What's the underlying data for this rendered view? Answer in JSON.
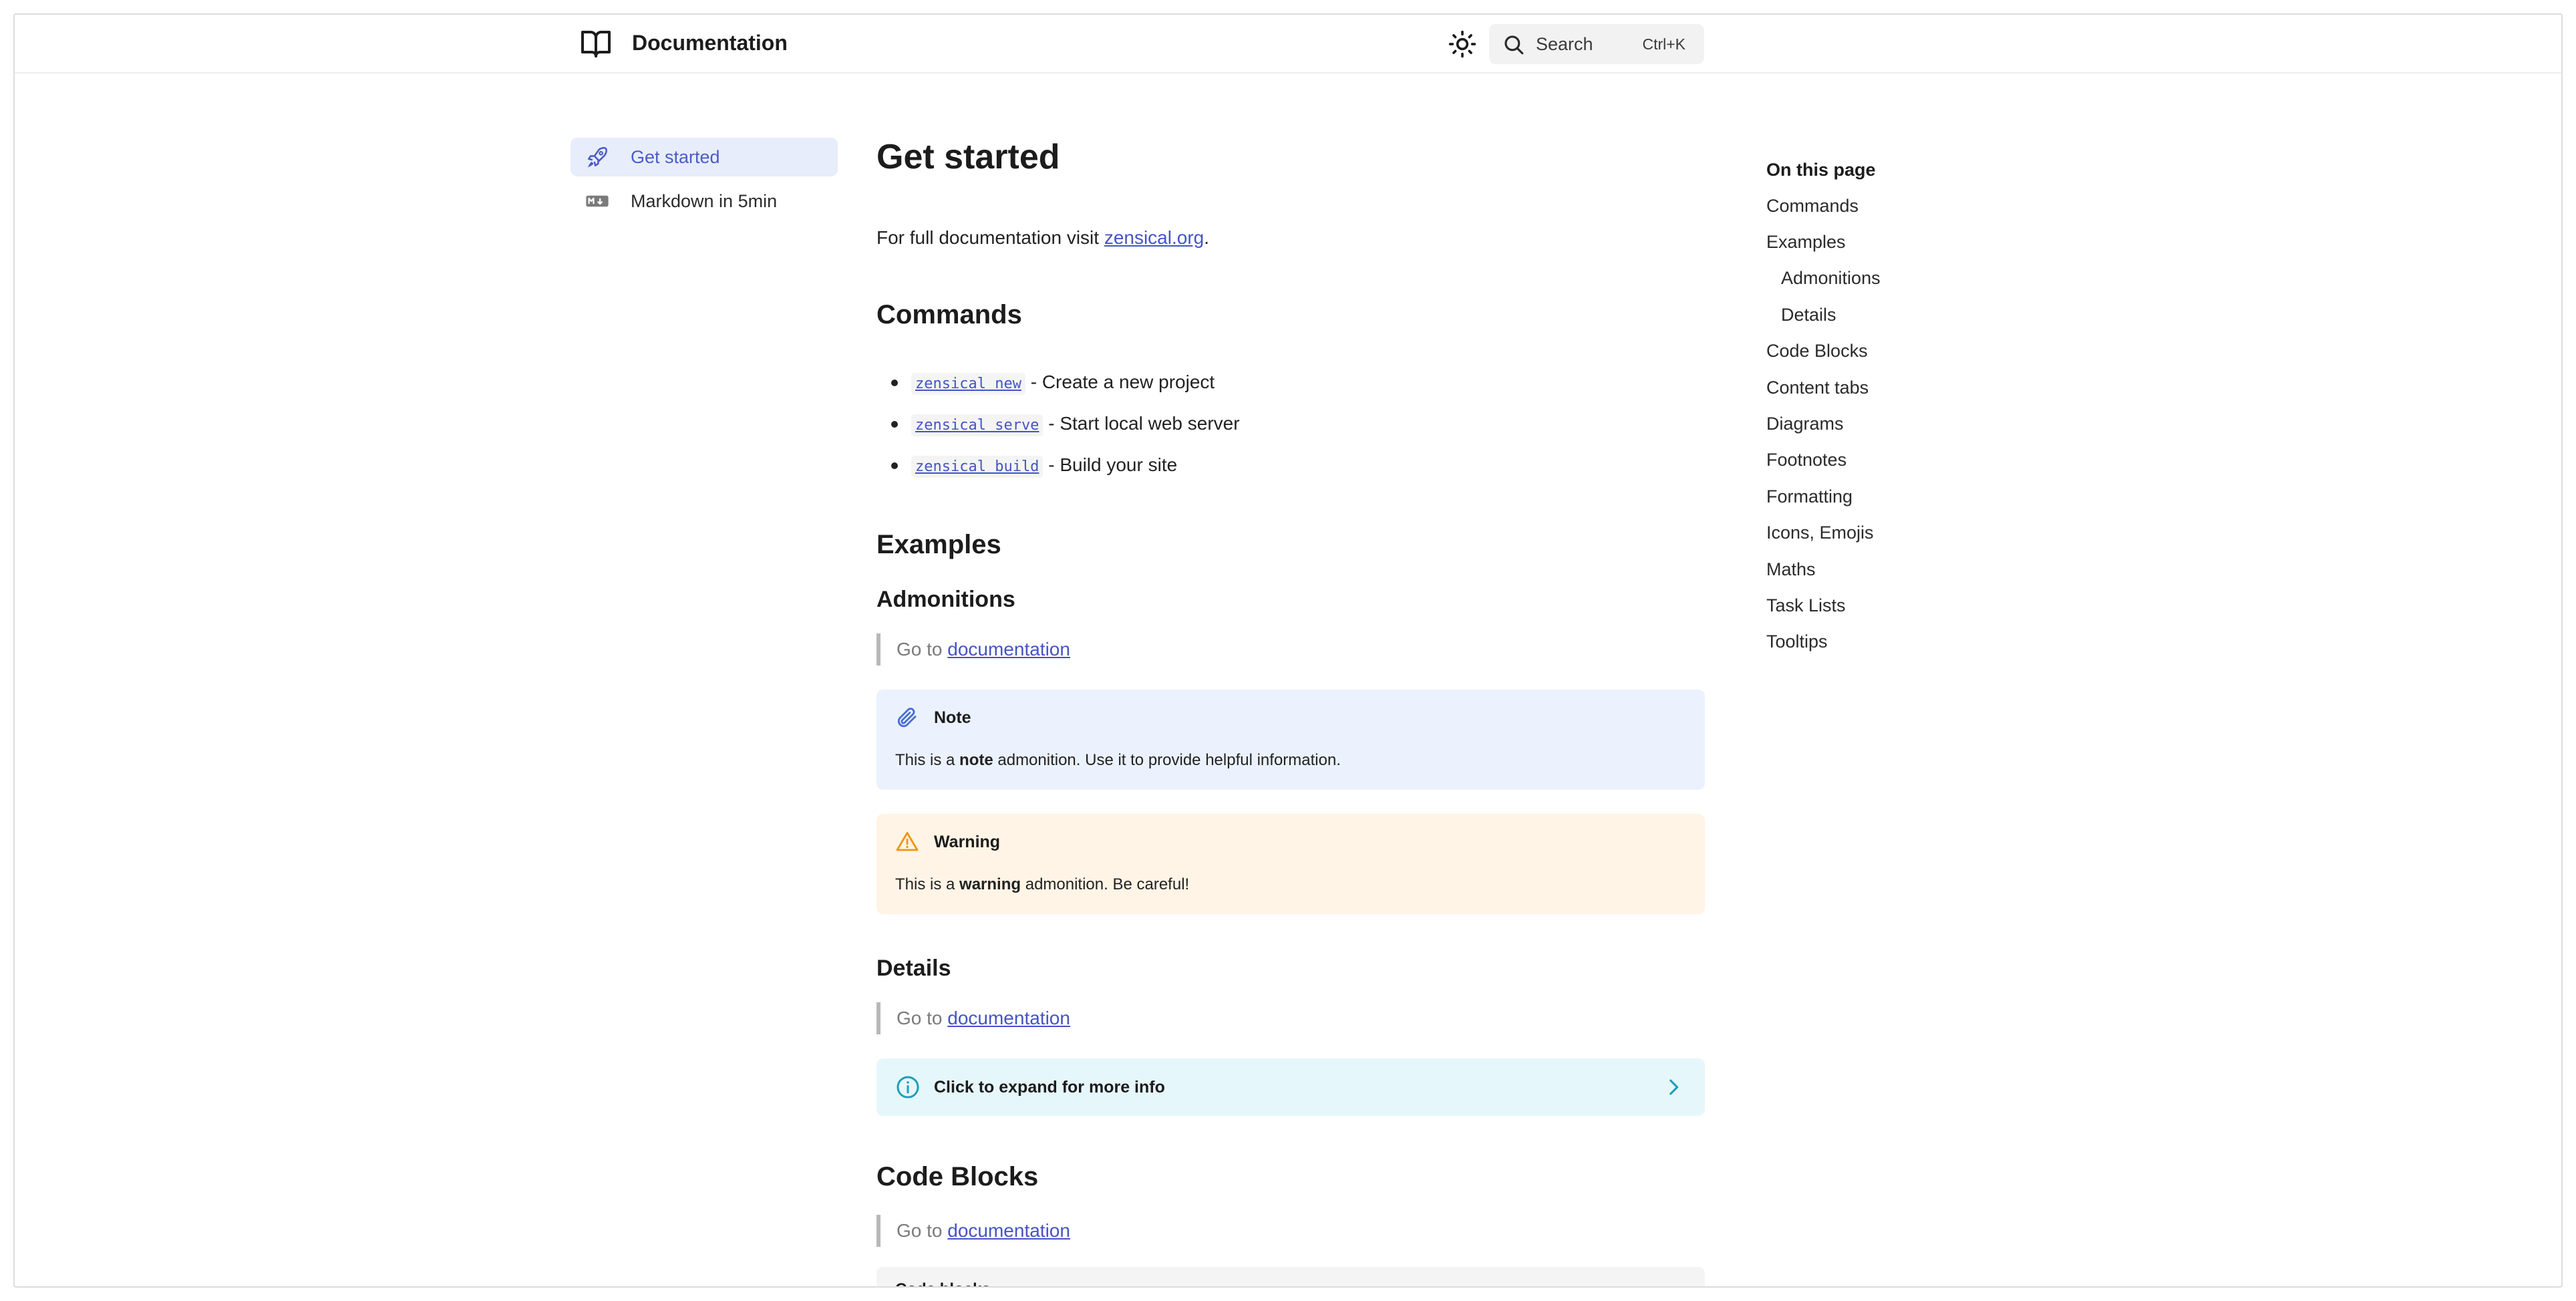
{
  "header": {
    "title": "Documentation",
    "search_label": "Search",
    "search_shortcut": "Ctrl+K",
    "icons": [
      "book-icon",
      "sun-icon",
      "search-icon"
    ]
  },
  "sidebar": {
    "items": [
      {
        "label": "Get started",
        "icon": "rocket-icon",
        "active": true
      },
      {
        "label": "Markdown in 5min",
        "icon": "markdown-icon",
        "active": false
      }
    ]
  },
  "main": {
    "title": "Get started",
    "intro_prefix": "For full documentation visit ",
    "intro_link": "zensical.org",
    "intro_suffix": ".",
    "commands_heading": "Commands",
    "commands": [
      {
        "code": "zensical new",
        "desc": " - Create a new project"
      },
      {
        "code": "zensical serve",
        "desc": " - Start local web server"
      },
      {
        "code": "zensical build",
        "desc": " - Build your site"
      }
    ],
    "examples_heading": "Examples",
    "admonitions_heading": "Admonitions",
    "goto_prefix": "Go to ",
    "goto_link": "documentation",
    "note": {
      "title": "Note",
      "body_prefix": "This is a ",
      "body_bold": "note",
      "body_suffix": " admonition. Use it to provide helpful information.",
      "color": "#ebf2fe"
    },
    "warning": {
      "title": "Warning",
      "body_prefix": "This is a ",
      "body_bold": "warning",
      "body_suffix": " admonition. Be careful!",
      "color": "#fff4e6"
    },
    "details_heading": "Details",
    "details_summary": "Click to expand for more info",
    "codeblocks_heading": "Code Blocks",
    "codeblock_title": "Code blocks"
  },
  "toc": {
    "title": "On this page",
    "items": [
      {
        "label": "Commands",
        "sub": false
      },
      {
        "label": "Examples",
        "sub": false
      },
      {
        "label": "Admonitions",
        "sub": true
      },
      {
        "label": "Details",
        "sub": true
      },
      {
        "label": "Code Blocks",
        "sub": false
      },
      {
        "label": "Content tabs",
        "sub": false
      },
      {
        "label": "Diagrams",
        "sub": false
      },
      {
        "label": "Footnotes",
        "sub": false
      },
      {
        "label": "Formatting",
        "sub": false
      },
      {
        "label": "Icons, Emojis",
        "sub": false
      },
      {
        "label": "Maths",
        "sub": false
      },
      {
        "label": "Task Lists",
        "sub": false
      },
      {
        "label": "Tooltips",
        "sub": false
      }
    ]
  },
  "colors": {
    "accent": "#4a5cc9",
    "link": "#4454c4",
    "active_nav_bg": "#e8edfb",
    "details_bg": "#e6f7fb",
    "info_icon": "#1aa0b8",
    "warning_icon": "#f0960e"
  }
}
